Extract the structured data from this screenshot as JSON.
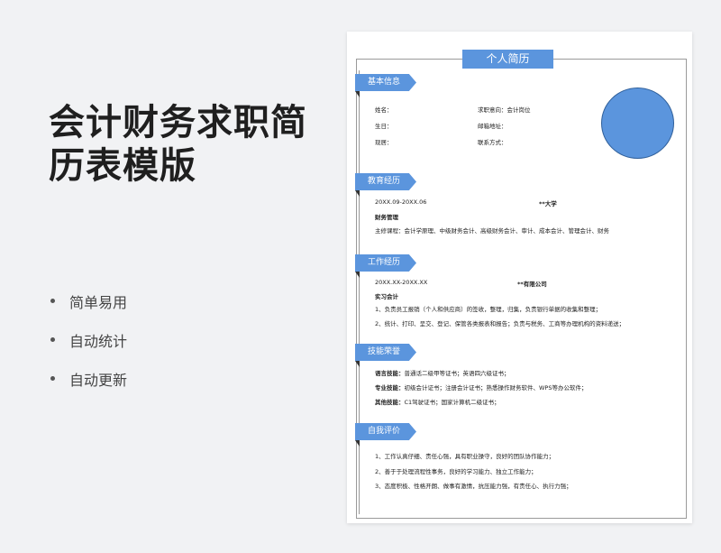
{
  "promo": {
    "title_line1": "会计财务求职简",
    "title_line2": "历表模版",
    "features": [
      "简单易用",
      "自动统计",
      "自动更新"
    ]
  },
  "resume": {
    "title": "个人简历",
    "sections": {
      "basic": "基本信息",
      "education": "教育经历",
      "work": "工作经历",
      "skills": "技能荣誉",
      "self": "自我评价"
    },
    "basic": {
      "name": "姓名：",
      "intent": "求职意向：会计岗位",
      "birth": "生日：",
      "email": "邮箱地址：",
      "address": "现居：",
      "contact": "联系方式："
    },
    "education": {
      "period": "20XX.09-20XX.06",
      "school": "**大学",
      "major": "财务管理",
      "courses": "主修课程：会计学原理、中级财务会计、高级财务会计、审计、成本会计、管理会计、财务"
    },
    "work": {
      "period": "20XX.XX-20XX.XX",
      "company": "**有限公司",
      "role": "实习会计",
      "duty1": "1、负责员工报销（个人和供应商）的签收，整理，归集，负责银行单据的收集和整理；",
      "duty2": "2、统计、打印、呈交、登记、保管各类报表和报告；负责与税务、工商等办理机构的资料递送；"
    },
    "skills": {
      "lang_label": "语言技能：",
      "lang": "普通话二级甲等证书；英语四六级证书；",
      "pro_label": "专业技能：",
      "pro": "初级会计证书；注册会计证书；熟悉操作财务软件、WPS等办公软件；",
      "other_label": "其他技能：",
      "other": "C1驾驶证书；国家计算机二级证书；"
    },
    "self": {
      "item1": "1、工作认真仔细、责任心强，具有职业操守，良好的团队协作能力；",
      "item2": "2、善于于处理流程性事务，良好的学习能力、独立工作能力；",
      "item3": "3、态度积极、性格开朗、做事有激情，抗压能力强，有责任心、执行力强；"
    }
  },
  "colors": {
    "accent": "#5b95dd",
    "title": "#1f1f1f"
  }
}
